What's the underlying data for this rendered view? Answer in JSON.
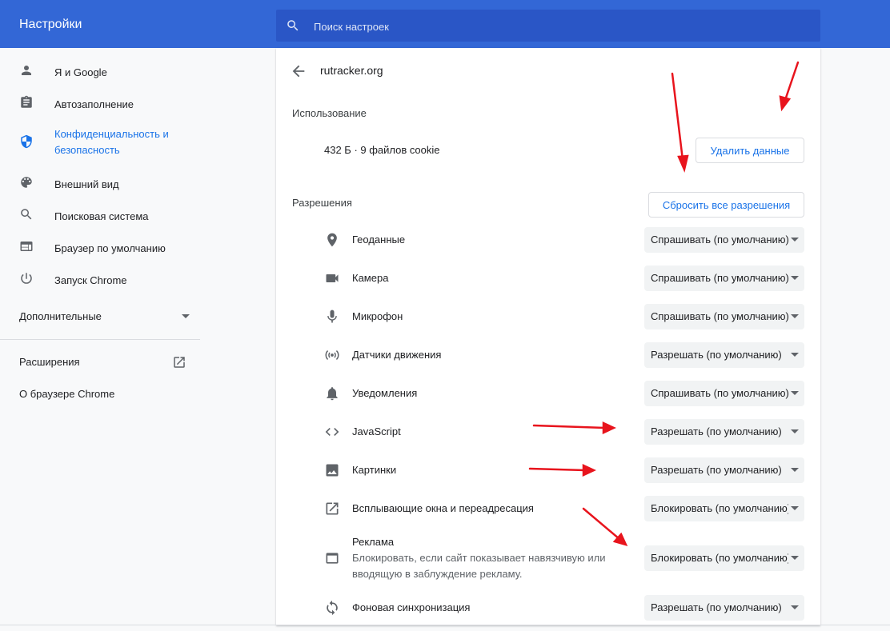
{
  "header": {
    "title": "Настройки",
    "search_placeholder": "Поиск настроек"
  },
  "sidebar": {
    "items": [
      {
        "label": "Я и Google",
        "icon": "person-icon"
      },
      {
        "label": "Автозаполнение",
        "icon": "clipboard-icon"
      },
      {
        "label": "Конфиденциальность и безопасность",
        "icon": "shield-icon",
        "active": true
      },
      {
        "label": "Внешний вид",
        "icon": "palette-icon"
      },
      {
        "label": "Поисковая система",
        "icon": "search-icon"
      },
      {
        "label": "Браузер по умолчанию",
        "icon": "browser-icon"
      },
      {
        "label": "Запуск Chrome",
        "icon": "power-icon"
      }
    ],
    "advanced_label": "Дополнительные",
    "extensions_label": "Расширения",
    "about_label": "О браузере Chrome"
  },
  "site": {
    "title": "rutracker.org"
  },
  "usage": {
    "heading": "Использование",
    "text": "432 Б · 9 файлов cookie",
    "clear_button": "Удалить данные"
  },
  "permissions": {
    "heading": "Разрешения",
    "reset_button": "Сбросить все разрешения",
    "items": [
      {
        "label": "Геоданные",
        "value": "Спрашивать (по умолчанию)",
        "icon": "location-icon"
      },
      {
        "label": "Камера",
        "value": "Спрашивать (по умолчанию)",
        "icon": "camera-icon"
      },
      {
        "label": "Микрофон",
        "value": "Спрашивать (по умолчанию)",
        "icon": "microphone-icon"
      },
      {
        "label": "Датчики движения",
        "value": "Разрешать (по умолчанию)",
        "icon": "sensors-icon"
      },
      {
        "label": "Уведомления",
        "value": "Спрашивать (по умолчанию)",
        "icon": "bell-icon"
      },
      {
        "label": "JavaScript",
        "value": "Разрешать (по умолчанию)",
        "icon": "code-icon"
      },
      {
        "label": "Картинки",
        "value": "Разрешать (по умолчанию)",
        "icon": "image-icon"
      },
      {
        "label": "Всплывающие окна и переадресация",
        "value": "Блокировать (по умолчанию)",
        "icon": "open-external-icon"
      },
      {
        "label": "Реклама",
        "sublabel": "Блокировать, если сайт показывает навязчивую или вводящую в заблуждение рекламу.",
        "value": "Блокировать (по умолчанию)",
        "icon": "ads-icon"
      },
      {
        "label": "Фоновая синхронизация",
        "value": "Разрешать (по умолчанию)",
        "icon": "sync-icon"
      }
    ]
  },
  "colors": {
    "header_bg": "#3367d6",
    "accent": "#1a73e8",
    "annotation_arrows": "#e8141d"
  }
}
